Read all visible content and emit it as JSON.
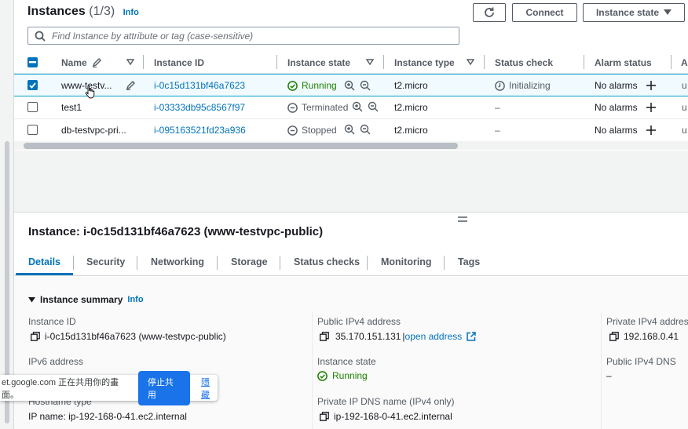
{
  "header": {
    "title": "Instances",
    "count": "(1/3)",
    "info": "Info",
    "connect_label": "Connect",
    "instance_state_label": "Instance state"
  },
  "search": {
    "placeholder": "Find Instance by attribute or tag (case-sensitive)"
  },
  "table": {
    "columns": [
      "Name",
      "Instance ID",
      "Instance state",
      "Instance type",
      "Status check",
      "Alarm status",
      "A"
    ],
    "rows": [
      {
        "selected": true,
        "name": "www-testv...",
        "id": "i-0c15d131bf46a7623",
        "state": "Running",
        "state_icon": "check-circle-icon",
        "type": "t2.micro",
        "status_check": "Initializing",
        "alarm": "No alarms",
        "extra": "u"
      },
      {
        "selected": false,
        "name": "test1",
        "id": "i-03333db95c8567f97",
        "state": "Terminated",
        "state_icon": "minus-circle-icon",
        "type": "t2.micro",
        "status_check": "–",
        "alarm": "No alarms",
        "extra": "u"
      },
      {
        "selected": false,
        "name": "db-testvpc-pri...",
        "id": "i-095163521fd23a936",
        "state": "Stopped",
        "state_icon": "minus-circle-icon",
        "type": "t2.micro",
        "status_check": "–",
        "alarm": "No alarms",
        "extra": "u"
      }
    ]
  },
  "detail": {
    "title": "Instance: i-0c15d131bf46a7623 (www-testvpc-public)",
    "tabs": [
      "Details",
      "Security",
      "Networking",
      "Storage",
      "Status checks",
      "Monitoring",
      "Tags"
    ],
    "active_tab": "Details",
    "summary_title": "Instance summary",
    "summary_info": "Info",
    "fields": {
      "instance_id_label": "Instance ID",
      "instance_id_value": "i-0c15d131bf46a7623 (www-testvpc-public)",
      "public_ipv4_label": "Public IPv4 address",
      "public_ipv4_value": "35.170.151.131",
      "open_address": "open address",
      "private_ipv4_label": "Private IPv4 addres",
      "private_ipv4_value": "192.168.0.41",
      "ipv6_label": "IPv6 address",
      "instance_state_label": "Instance state",
      "instance_state_value": "Running",
      "public_dns_label": "Public IPv4 DNS",
      "public_dns_value": "–",
      "hostname_type_label": "Hostname type",
      "hostname_value": "IP name: ip-192-168-0-41.ec2.internal",
      "private_dns_label": "Private IP DNS name (IPv4 only)",
      "private_dns_value": "ip-192-168-0-41.ec2.internal"
    }
  },
  "share_bar": {
    "text": "et.google.com 正在共用你的畫面。",
    "stop_button": "停止共用",
    "hide_link": "隱藏"
  },
  "colors": {
    "accent": "#0073bb",
    "running": "#1d8102",
    "share_blue": "#1a73e8"
  }
}
